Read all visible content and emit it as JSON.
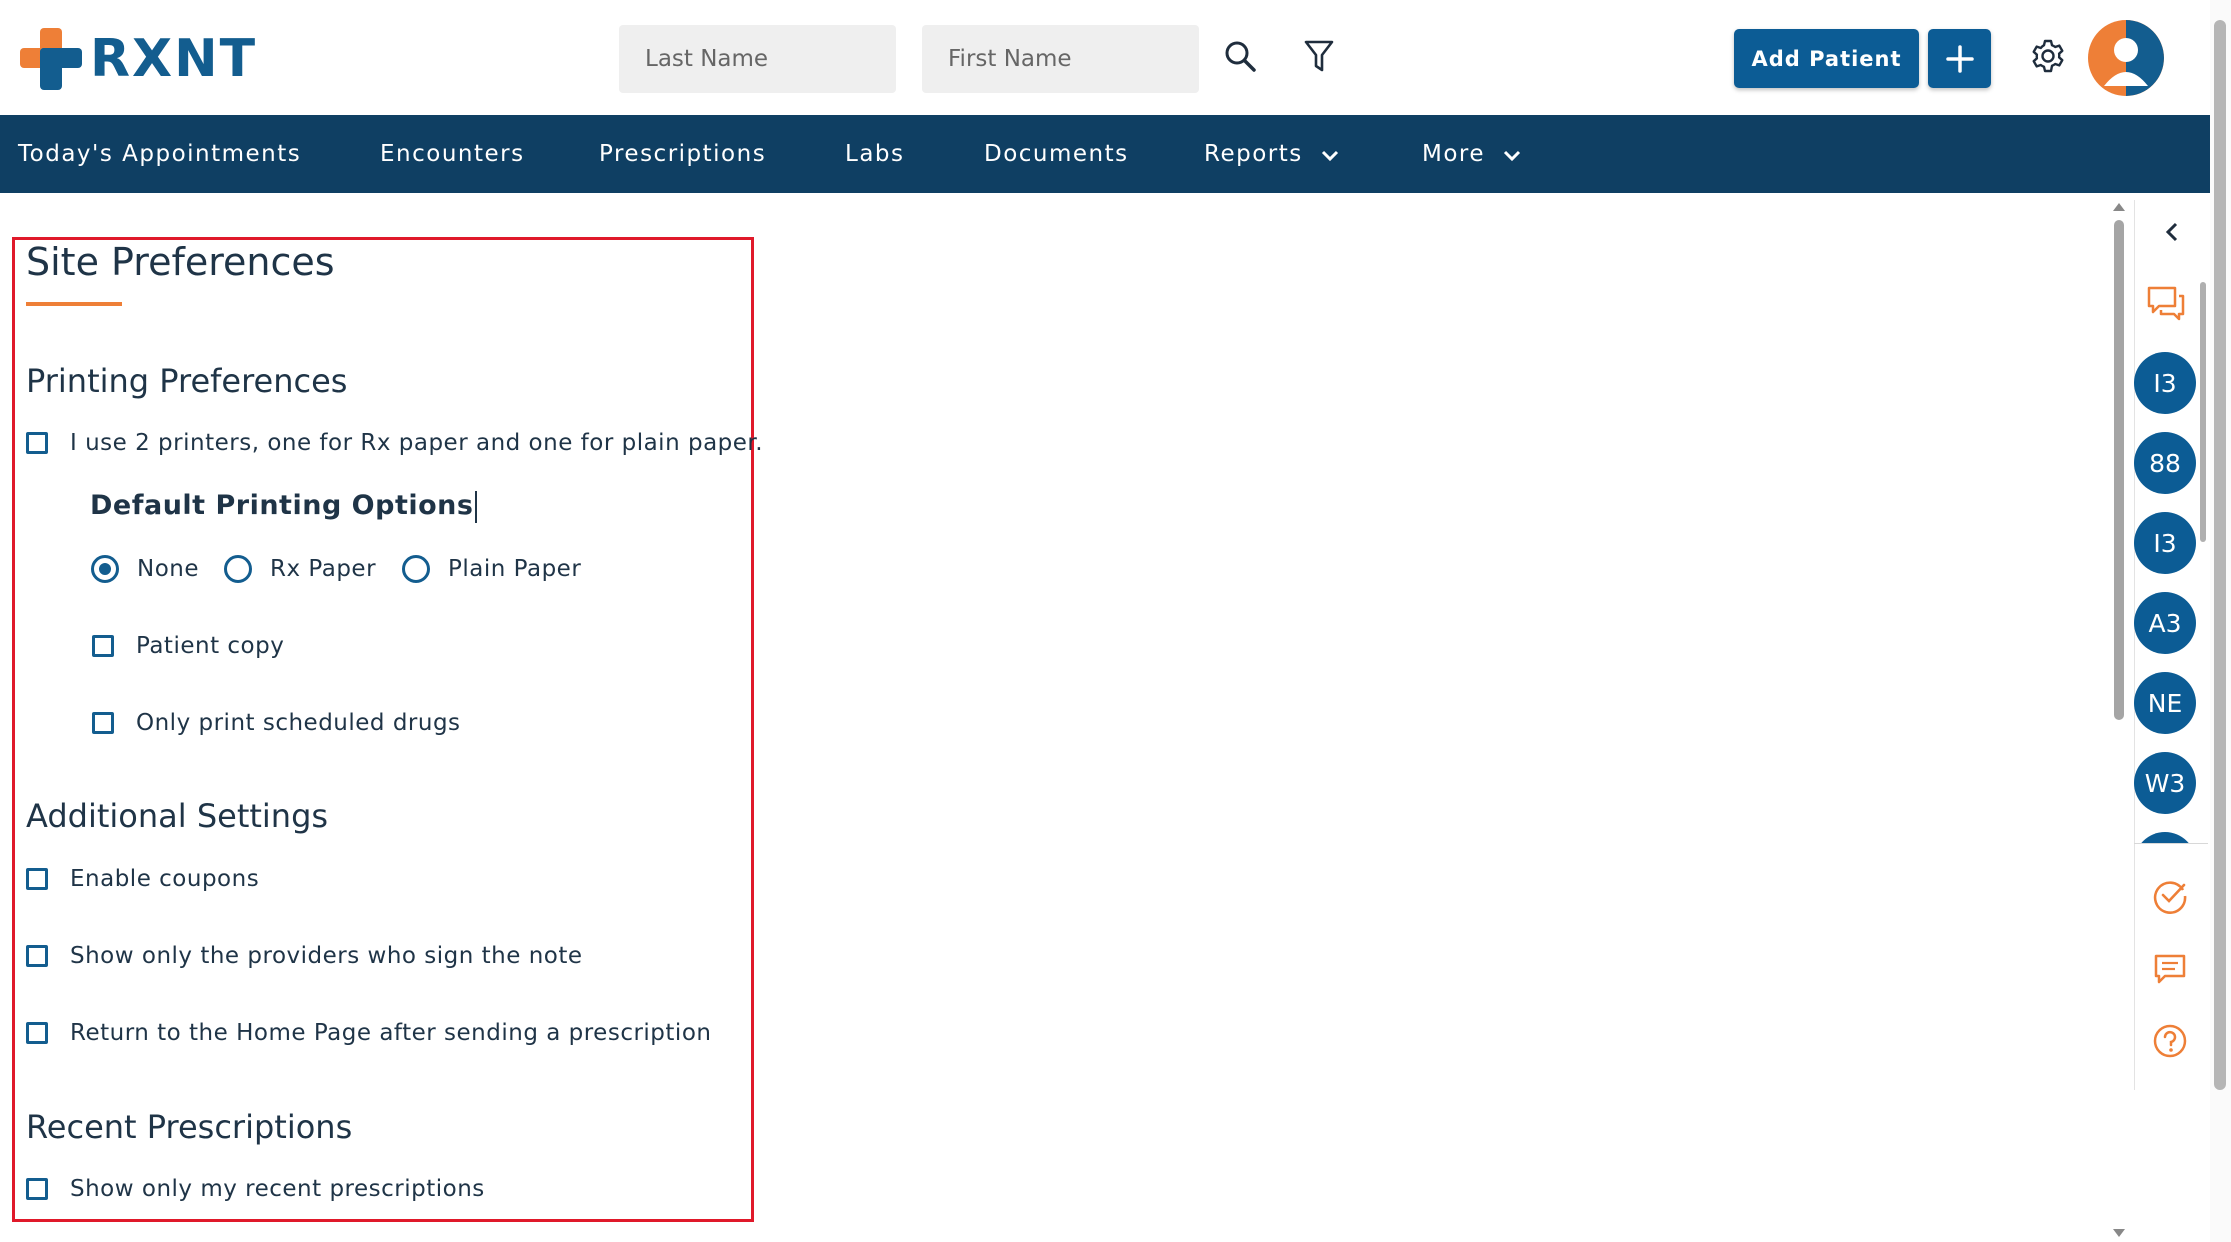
{
  "app": {
    "logo_text": "RXNT"
  },
  "header": {
    "last_name_placeholder": "Last Name",
    "first_name_placeholder": "First Name",
    "add_patient_label": "Add Patient"
  },
  "nav": {
    "items": [
      {
        "label": "Today's Appointments"
      },
      {
        "label": "Encounters"
      },
      {
        "label": "Prescriptions"
      },
      {
        "label": "Labs"
      },
      {
        "label": "Documents"
      },
      {
        "label": "Reports"
      },
      {
        "label": "More"
      }
    ]
  },
  "page": {
    "title": "Site Preferences",
    "printing": {
      "heading": "Printing Preferences",
      "two_printers_label": "I use 2 printers, one for Rx paper and one for plain paper.",
      "default_options_heading": "Default Printing Options",
      "radio_options": [
        {
          "label": "None",
          "selected": true
        },
        {
          "label": "Rx Paper",
          "selected": false
        },
        {
          "label": "Plain Paper",
          "selected": false
        }
      ],
      "patient_copy_label": "Patient copy",
      "scheduled_drugs_label": "Only print scheduled drugs"
    },
    "additional": {
      "heading": "Additional Settings",
      "enable_coupons_label": "Enable coupons",
      "providers_sign_label": "Show only the providers who sign the note",
      "return_home_label": "Return to the Home Page after sending a prescription"
    },
    "recent": {
      "heading": "Recent Prescriptions",
      "only_mine_label": "Show only my recent prescriptions"
    }
  },
  "rail": {
    "badges": [
      "I3",
      "88",
      "I3",
      "A3",
      "NE",
      "W3"
    ]
  },
  "colors": {
    "brand_blue": "#0c5c95",
    "nav_bg": "#0f3f63",
    "accent_orange": "#ee7f37",
    "highlight_red": "#e0192a"
  }
}
